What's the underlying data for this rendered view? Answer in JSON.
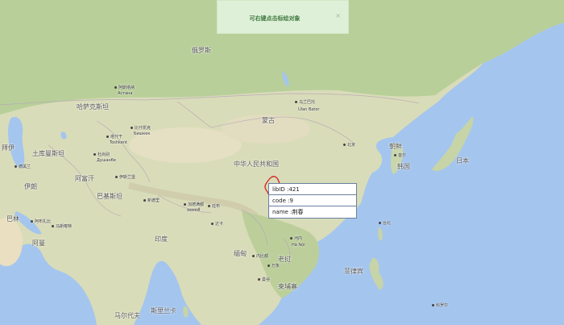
{
  "notification": {
    "message": "可右键点击标绘对象",
    "close_glyph": "×"
  },
  "popup": {
    "rows": [
      {
        "key": "libID",
        "value": "421"
      },
      {
        "key": "code",
        "value": "9"
      },
      {
        "key": "name",
        "value": "荆春"
      }
    ]
  },
  "map": {
    "labels": {
      "russia": "俄罗斯",
      "kazakhstan": "哈萨克斯坦",
      "astana_cn": "阿斯塔纳",
      "astana_local": "Астана",
      "mongolia": "蒙古",
      "ulaanbaatar_cn": "乌兰巴托",
      "ulaanbaatar_local": "Ulan Bator",
      "bishkek_cn": "比什凯克",
      "bishkek_local": "Бишкек",
      "tashkent_cn": "塔什干",
      "tashkent_local": "Toshkent",
      "dushanbe_cn": "杜尚别",
      "dushanbe_local": "Душанбе",
      "turkmenistan": "土库曼斯坦",
      "tehran": "德黑兰",
      "iran": "伊朗",
      "afghanistan": "阿富汗",
      "islamabad": "伊斯兰堡",
      "pakistan": "巴基斯坦",
      "china": "中华人民共和国",
      "beijing": "北京",
      "seoul": "首尔",
      "north_korea": "朝鲜",
      "south_korea": "韩国",
      "japan": "日本",
      "kathmandu_cn": "加德满都",
      "kathmandu_local": "काठमाडौं",
      "new_delhi": "新德里",
      "thimphu": "廷布",
      "dhaka": "达卡",
      "india": "印度",
      "naypyidaw": "内比都",
      "burma": "缅甸",
      "hanoi_cn": "河内",
      "hanoi_local": "Hà Nội",
      "vientiane": "万象",
      "laos": "老挝",
      "bangkok": "曼谷",
      "cambodia": "柬埔寨",
      "philippines": "菲律宾",
      "taipei": "台北",
      "bahrain": "巴林",
      "abu_dhabi": "阿布扎比",
      "muscat": "马斯喀特",
      "oman": "阿曼",
      "maldives": "马尔代夫",
      "sri_lanka": "斯里兰卡",
      "koror": "科罗尔",
      "iraq_partial": "拜伊"
    }
  }
}
